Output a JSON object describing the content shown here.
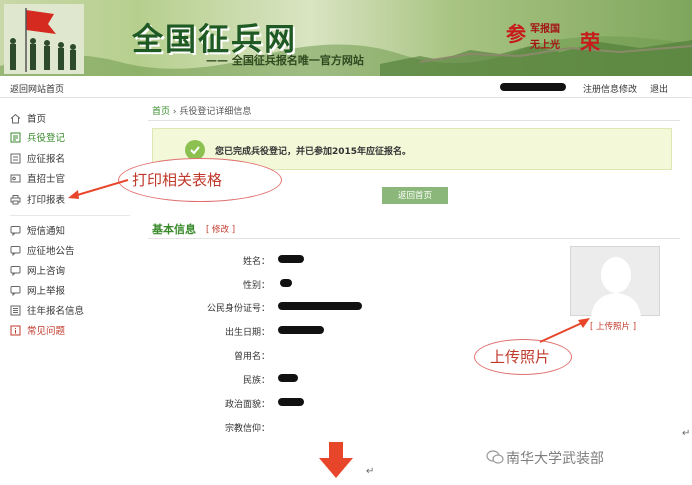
{
  "banner": {
    "site_title": "全国征兵网",
    "subtitle": "—— 全国征兵报名唯一官方网站",
    "slogan": {
      "big1": "参",
      "line1": "军报国",
      "line2": "无上光",
      "big2": "荣"
    }
  },
  "topbar": {
    "back_link": "返回网站首页",
    "modify_link": "注册信息修改",
    "logout_link": "退出"
  },
  "sidebar": {
    "items": [
      {
        "label": "首页",
        "icon": "home-icon",
        "state": "normal"
      },
      {
        "label": "兵役登记",
        "icon": "register-icon",
        "state": "active"
      },
      {
        "label": "应征报名",
        "icon": "form-icon",
        "state": "normal"
      },
      {
        "label": "直招士官",
        "icon": "card-icon",
        "state": "normal"
      },
      {
        "label": "打印报表",
        "icon": "printer-icon",
        "state": "normal"
      },
      {
        "label": "短信通知",
        "icon": "chat-icon",
        "state": "normal"
      },
      {
        "label": "应征地公告",
        "icon": "chat-icon",
        "state": "normal"
      },
      {
        "label": "网上咨询",
        "icon": "chat-icon",
        "state": "normal"
      },
      {
        "label": "网上举报",
        "icon": "chat-icon",
        "state": "normal"
      },
      {
        "label": "往年报名信息",
        "icon": "list-icon",
        "state": "normal"
      },
      {
        "label": "常见问题",
        "icon": "info-icon",
        "state": "red"
      }
    ]
  },
  "breadcrumb": {
    "home": "首页",
    "sep": "›",
    "current": "兵役登记详细信息"
  },
  "notice": {
    "message": "您已完成兵役登记，并已参加2015年应征报名。"
  },
  "home_button": "返回首页",
  "basic_info": {
    "title": "基本信息",
    "edit": "[ 修改 ]",
    "fields": [
      {
        "label": "姓名：",
        "redacted": true
      },
      {
        "label": "性别：",
        "redacted": true
      },
      {
        "label": "公民身份证号：",
        "redacted": true
      },
      {
        "label": "出生日期：",
        "redacted": true
      },
      {
        "label": "曾用名：",
        "redacted": false
      },
      {
        "label": "民族：",
        "redacted": true
      },
      {
        "label": "政治面貌：",
        "redacted": true
      },
      {
        "label": "宗教信仰：",
        "redacted": false
      }
    ]
  },
  "photo": {
    "upload_link": "[ 上传照片 ]"
  },
  "annotations": {
    "print_note": "打印相关表格",
    "photo_note": "上传照片",
    "arrow_color": "#e8462a"
  },
  "watermark": "南华大学武装部",
  "colors": {
    "accent_green": "#3a8a2c",
    "alert_red": "#c0392b",
    "notice_bg": "#f3f8d9"
  }
}
